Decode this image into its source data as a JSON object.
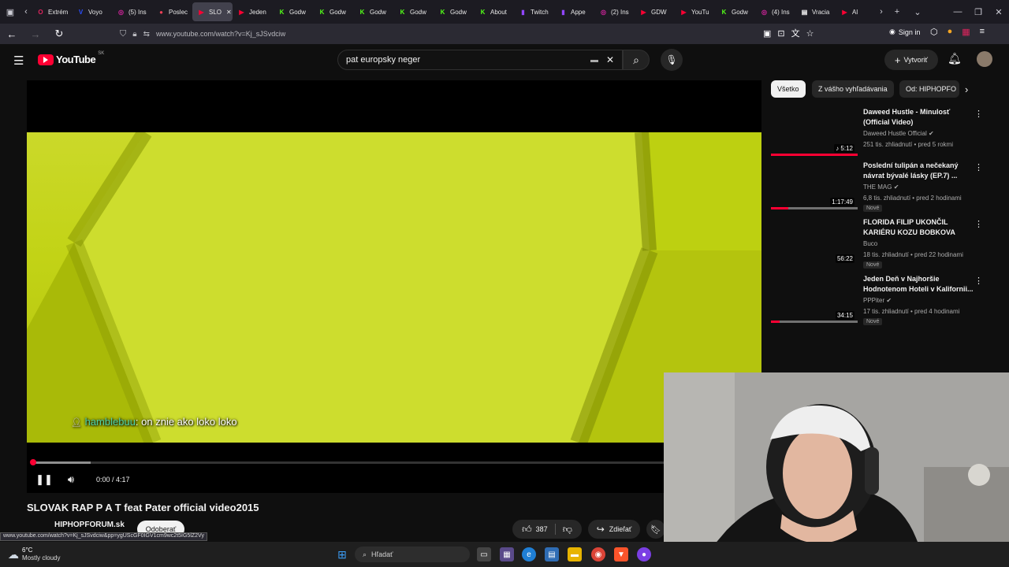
{
  "browser": {
    "tabs": [
      {
        "label": "Extrém",
        "icon": "opera-icon",
        "color": "#e0245e",
        "glyph": "O"
      },
      {
        "label": "Voyo",
        "icon": "voyo-icon",
        "color": "#2b4fff",
        "glyph": "V"
      },
      {
        "label": "(5) Ins",
        "icon": "instagram-icon",
        "color": "#d6249f",
        "glyph": "◎"
      },
      {
        "label": "Poslec",
        "icon": "pocket-icon",
        "color": "#ef4056",
        "glyph": "●"
      },
      {
        "label": "SLO",
        "icon": "youtube-icon",
        "color": "#ff0033",
        "glyph": "▶"
      },
      {
        "label": "Jeden",
        "icon": "youtube-icon",
        "color": "#ff0033",
        "glyph": "▶"
      },
      {
        "label": "Godw",
        "icon": "kick-icon",
        "color": "#53fc18",
        "glyph": "K"
      },
      {
        "label": "Godw",
        "icon": "kick-icon",
        "color": "#53fc18",
        "glyph": "K"
      },
      {
        "label": "Godw",
        "icon": "kick-icon",
        "color": "#53fc18",
        "glyph": "K"
      },
      {
        "label": "Godw",
        "icon": "kick-icon",
        "color": "#53fc18",
        "glyph": "K"
      },
      {
        "label": "Godw",
        "icon": "kick-icon",
        "color": "#53fc18",
        "glyph": "K"
      },
      {
        "label": "About",
        "icon": "kick-icon",
        "color": "#53fc18",
        "glyph": "K"
      },
      {
        "label": "Twitch",
        "icon": "twitch-icon",
        "color": "#9146ff",
        "glyph": "▮"
      },
      {
        "label": "Appe",
        "icon": "twitch-icon",
        "color": "#9146ff",
        "glyph": "▮"
      },
      {
        "label": "(2) Ins",
        "icon": "instagram-icon",
        "color": "#d6249f",
        "glyph": "◎"
      },
      {
        "label": "GDW",
        "icon": "youtube-icon",
        "color": "#ff0033",
        "glyph": "▶"
      },
      {
        "label": "YouTu",
        "icon": "youtube-icon",
        "color": "#ff0033",
        "glyph": "▶"
      },
      {
        "label": "Godw",
        "icon": "kick-icon",
        "color": "#53fc18",
        "glyph": "K"
      },
      {
        "label": "(4) Ins",
        "icon": "instagram-icon",
        "color": "#d6249f",
        "glyph": "◎"
      },
      {
        "label": "Vracia",
        "icon": "page-icon",
        "color": "#ffffff",
        "glyph": "▤"
      },
      {
        "label": "Al",
        "icon": "youtube-icon",
        "color": "#ff0033",
        "glyph": "▶"
      }
    ],
    "url": "www.youtube.com/watch?v=Kj_sJSvdciw",
    "signin_label": "Sign in",
    "status_url": "www.youtube.com/watch?v=Kj_sJSvdciw&pp=ygUScGF0IGV1cm9wc2t5IG5lZ2Vy"
  },
  "youtube": {
    "logo_text": "YouTube",
    "region": "SK",
    "search_query": "pat europsky neger",
    "create_label": "Vytvoriť",
    "video": {
      "title": "SLOVAK RAP P A T feat Pater official video2015",
      "time": "0:00 / 4:17",
      "progress_fraction": 0.0,
      "buffered_fraction": 0.08,
      "chat_user": "hamblebuu",
      "chat_text": ": on znie ako loko loko"
    },
    "channel": {
      "name": "HIPHOPFORUM.sk",
      "subscribe_label": "Odoberať"
    },
    "actions": {
      "likes": "387",
      "share_label": "Zdieľať"
    },
    "chips": [
      "Všetko",
      "Z vášho vyhľadávania",
      "Od: HIPHOPFO"
    ],
    "recommendations": [
      {
        "title": "Daweed Hustle - Minulosť (Official Video)",
        "channel": "Daweed Hustle Official",
        "verified": true,
        "meta": "251 tis. zhliadnutí • pred 5 rokmi",
        "duration": "♪ 5:12",
        "is_new": false,
        "watched_fraction": 1.0
      },
      {
        "title": "Poslední tulipán a nečekaný návrat bývalé lásky (EP.7) ...",
        "channel": "THE MAG",
        "verified": true,
        "meta": "6,8 tis. zhliadnutí • pred 2 hodinami",
        "duration": "1:17:49",
        "is_new": true,
        "watched_fraction": 0.2
      },
      {
        "title": "FLORIDA FILIP UKONČIL KARIÉRU KOZU BOBKOVA",
        "channel": "Buco",
        "verified": false,
        "meta": "18 tis. zhliadnutí • pred 22 hodinami",
        "duration": "56:22",
        "is_new": true,
        "watched_fraction": 0.0
      },
      {
        "title": "Jeden Deň v Najhoršie Hodnotenom Hoteli v Kalifornii...",
        "channel": "PPPiter",
        "verified": true,
        "meta": "17 tis. zhliadnutí • pred 4 hodinami",
        "duration": "34:15",
        "is_new": true,
        "watched_fraction": 0.1
      }
    ],
    "new_badge": "Nové"
  },
  "taskbar": {
    "weather_temp": "6°C",
    "weather_desc": "Mostly cloudy",
    "search_placeholder": "Hľadať"
  },
  "colors": {
    "youtube_red": "#ff0033",
    "video_green": "#c2d316",
    "chat_user_color": "#4fd2a7"
  }
}
